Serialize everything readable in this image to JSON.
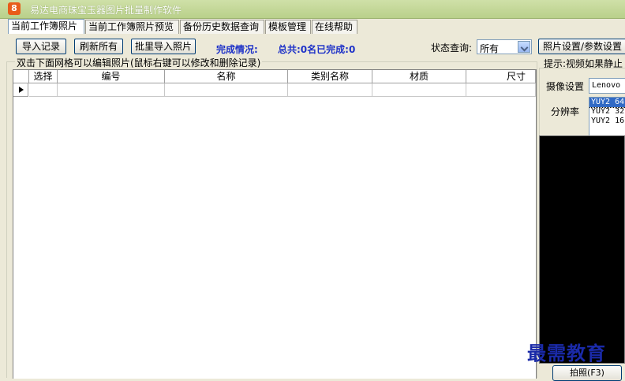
{
  "window": {
    "title": "易达电商珠宝玉器图片批量制作软件",
    "icon_glyph": "8"
  },
  "tabs": [
    {
      "label": "当前工作簿照片",
      "active": true
    },
    {
      "label": "当前工作簿照片预览",
      "active": false
    },
    {
      "label": "备份历史数据查询",
      "active": false
    },
    {
      "label": "模板管理",
      "active": false
    },
    {
      "label": "在线帮助",
      "active": false
    }
  ],
  "toolbar": {
    "import_label": "导入记录",
    "refresh_label": "刷新所有",
    "batch_import_label": "批里导入照片",
    "completion_label": "完成情况:",
    "total_label": "总共:0名已完成:0",
    "status_query_label": "状态查询:",
    "status_query_value": "所有",
    "settings_label": "照片设置/参数设置"
  },
  "grid": {
    "caption": "双击下面网格可以编辑照片(鼠标右键可以修改和删除记录)",
    "columns": [
      "选择",
      "编号",
      "名称",
      "类别名称",
      "材质",
      "尺寸"
    ]
  },
  "camera": {
    "hint": "提示:视频如果静止",
    "device_label": "摄像设置",
    "device_value": "Lenovo",
    "resolution_label": "分辨率",
    "resolutions": [
      "YUY2 64",
      "YUY2 32",
      "YUY2 16"
    ],
    "selected_resolution_index": 0,
    "capture_label": "拍照(F3)"
  },
  "watermark": "最需教育",
  "colors": {
    "titlebar": "#b9d08a",
    "status_text": "#1e32c8",
    "selection": "#316ac5"
  }
}
